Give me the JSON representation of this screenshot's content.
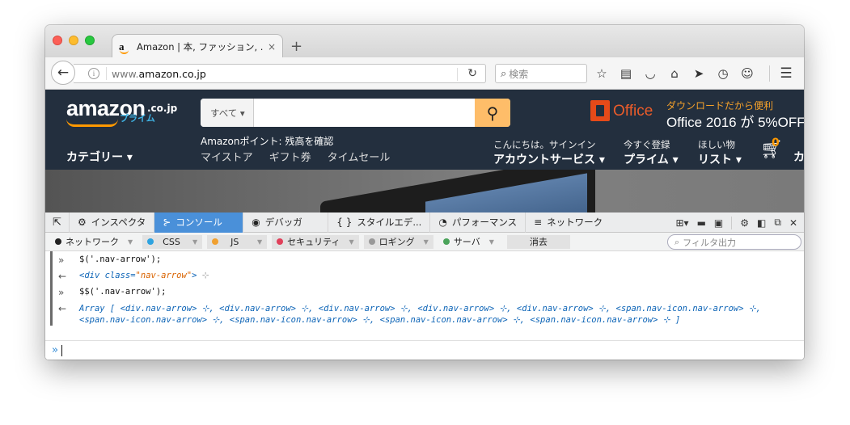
{
  "browser": {
    "tab_title": "Amazon | 本, ファッション, ...",
    "tab_close": "×",
    "new_tab": "+",
    "url_prefix": "www.",
    "url_domain": "amazon.co.jp",
    "search_placeholder": "検索"
  },
  "amazon": {
    "logo": "amazon",
    "logo_tld": ".co.jp",
    "logo_prime": "プライム",
    "search_category": "すべて ▾",
    "office_brand": "Office",
    "promo_line1": "ダウンロードだから便利",
    "promo_line2": "Office 2016 が 5%OFF",
    "category_label": "カテゴリー ▾",
    "points_text": "Amazonポイント: 残高を確認",
    "sub_links": [
      "マイストア",
      "ギフト券",
      "タイムセール"
    ],
    "account": [
      {
        "line1": "こんにちは。サインイン",
        "line2": "アカウントサービス ▾"
      },
      {
        "line1": "今すぐ登録",
        "line2": "プライム ▾"
      },
      {
        "line1": "ほしい物",
        "line2": "リスト ▾"
      }
    ],
    "cart_count": "0",
    "cart_label": "カ"
  },
  "devtools": {
    "tabs": [
      {
        "icon": "⚙",
        "label": "インスペクタ",
        "active": false
      },
      {
        "icon": "⊱",
        "label": "コンソール",
        "active": true
      },
      {
        "icon": "◉",
        "label": "デバッガ",
        "active": false
      },
      {
        "icon": "{ }",
        "label": "スタイルエデ...",
        "active": false
      },
      {
        "icon": "◔",
        "label": "パフォーマンス",
        "active": false
      },
      {
        "icon": "≡",
        "label": "ネットワーク",
        "active": false
      }
    ],
    "filters": [
      {
        "label": "ネットワーク",
        "color": "#222222"
      },
      {
        "label": "CSS",
        "color": "#2ea3e0"
      },
      {
        "label": "JS",
        "color": "#f0a030"
      },
      {
        "label": "セキュリティ",
        "color": "#e0405a"
      },
      {
        "label": "ロギング",
        "color": "#999999"
      },
      {
        "label": "サーバ",
        "color": "#4aa35a"
      }
    ],
    "clear_label": "消去",
    "filter_placeholder": "フィルタ出力",
    "console": {
      "cmd1": "$('.nav-arrow');",
      "out1_tag": "<div ",
      "out1_attr": "class=",
      "out1_val": "\"nav-arrow\"",
      "out1_end": ">",
      "cmd2": "$$('.nav-arrow');",
      "out2": "Array [ <div.nav-arrow> ⊹, <div.nav-arrow> ⊹, <div.nav-arrow> ⊹, <div.nav-arrow> ⊹, <div.nav-arrow> ⊹, <span.nav-icon.nav-arrow> ⊹, <span.nav-icon.nav-arrow> ⊹, <span.nav-icon.nav-arrow> ⊹, <span.nav-icon.nav-arrow> ⊹, <span.nav-icon.nav-arrow> ⊹ ]"
    },
    "prompt": "»"
  }
}
